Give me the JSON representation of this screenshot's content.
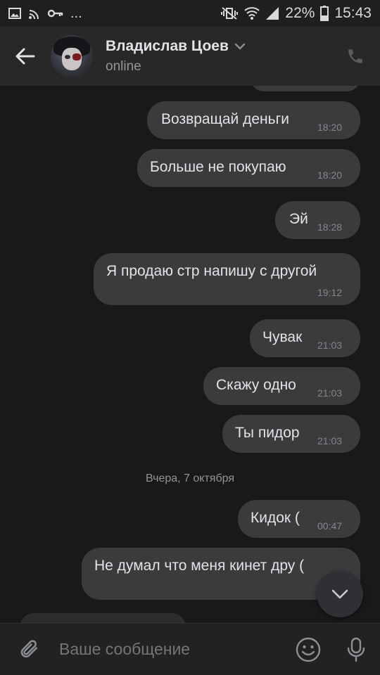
{
  "status_bar": {
    "icons_left": [
      "image-icon",
      "cast-icon",
      "key-icon"
    ],
    "more": "...",
    "battery": "22%",
    "time": "15:43"
  },
  "header": {
    "name": "Владислав Цоев",
    "status": "online"
  },
  "messages": [
    {
      "text": "Возвращай деньги",
      "time": "18:20"
    },
    {
      "text": "Больше не покупаю",
      "time": "18:20"
    },
    {
      "text": "Эй",
      "time": "18:28"
    },
    {
      "text": "Я продаю стр напишу с другой",
      "time": "19:12"
    },
    {
      "text": "Чувак",
      "time": "21:03"
    },
    {
      "text": "Скажу одно",
      "time": "21:03"
    },
    {
      "text": "Ты пидор",
      "time": "21:03"
    }
  ],
  "date_separator": "Вчера, 7 октября",
  "messages_after": [
    {
      "text": "Кидок (",
      "time": "00:47"
    },
    {
      "text": "Не думал что меня кинет дру (",
      "time": ""
    }
  ],
  "composer": {
    "placeholder": "Ваше сообщение"
  },
  "colors": {
    "background": "#19191a",
    "bubble": "#3a3b3c",
    "header": "#282829"
  }
}
